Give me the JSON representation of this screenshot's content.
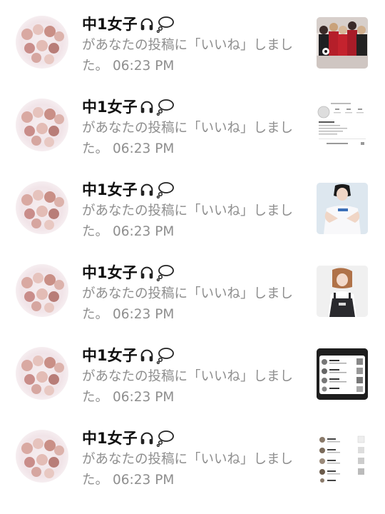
{
  "notifications": [
    {
      "user": "中1女子",
      "name_icons": [
        "headphones-icon",
        "thought-bubble-icon"
      ],
      "message": "があなたの投稿に「いいね」しました。",
      "time": "06:23 PM",
      "thumbnail": "group-photo-red-outfits"
    },
    {
      "user": "中1女子",
      "name_icons": [
        "headphones-icon",
        "thought-bubble-icon"
      ],
      "message": "があなたの投稿に「いいね」しました。",
      "time": "06:23 PM",
      "thumbnail": "profile-screenshot"
    },
    {
      "user": "中1女子",
      "name_icons": [
        "headphones-icon",
        "thought-bubble-icon"
      ],
      "message": "があなたの投稿に「いいね」しました。",
      "time": "06:23 PM",
      "thumbnail": "person-white-tshirt"
    },
    {
      "user": "中1女子",
      "name_icons": [
        "headphones-icon",
        "thought-bubble-icon"
      ],
      "message": "があなたの投稿に「いいね」しました。",
      "time": "06:23 PM",
      "thumbnail": "person-overalls"
    },
    {
      "user": "中1女子",
      "name_icons": [
        "headphones-icon",
        "thought-bubble-icon"
      ],
      "message": "があなたの投稿に「いいね」しました。",
      "time": "06:23 PM",
      "thumbnail": "dark-list-screenshot"
    },
    {
      "user": "中1女子",
      "name_icons": [
        "headphones-icon",
        "thought-bubble-icon"
      ],
      "message": "があなたの投稿に「いいね」しました。",
      "time": "06:23 PM",
      "thumbnail": "light-list-screenshot"
    }
  ]
}
